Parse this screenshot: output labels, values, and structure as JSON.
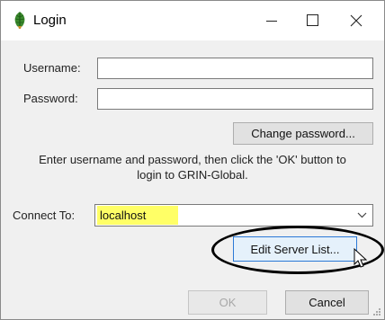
{
  "window": {
    "title": "Login",
    "icon": "grin-global-leaf-icon"
  },
  "form": {
    "username_label": "Username:",
    "username_value": "",
    "password_label": "Password:",
    "password_value": "",
    "change_password_label": "Change password...",
    "info_line1": "Enter username and password, then click the 'OK' button to",
    "info_line2": "login to GRIN-Global.",
    "connect_label": "Connect To:",
    "connect_value": "localhost",
    "edit_server_list_label": "Edit Server List...",
    "ok_label": "OK",
    "cancel_label": "Cancel"
  },
  "annotations": {
    "highlight_color": "#ffff66",
    "circle_color": "#000000"
  }
}
